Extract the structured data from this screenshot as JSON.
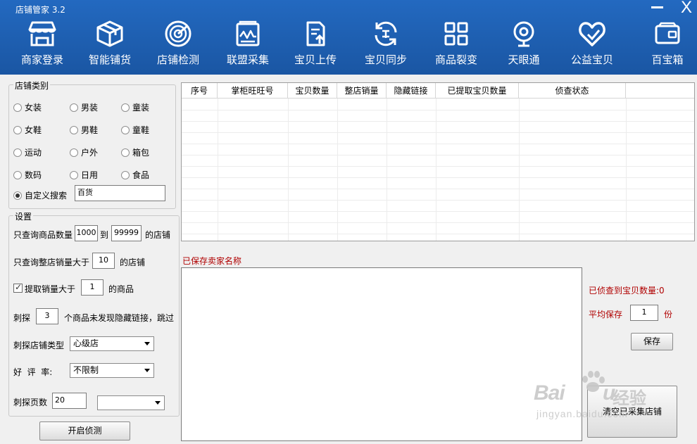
{
  "window": {
    "title": "店铺管家   3.2",
    "minimize_icon": "minimize-icon",
    "close_label": "X"
  },
  "nav": [
    {
      "label": "商家登录",
      "icon": "storefront-icon"
    },
    {
      "label": "智能铺货",
      "icon": "package-box-icon"
    },
    {
      "label": "店铺检测",
      "icon": "radar-icon"
    },
    {
      "label": "联盟采集",
      "icon": "pulse-chart-icon"
    },
    {
      "label": "宝贝上传",
      "icon": "document-upload-icon"
    },
    {
      "label": "宝贝同步",
      "icon": "sync-icon"
    },
    {
      "label": "商品裂变",
      "icon": "grid-icon"
    },
    {
      "label": "天眼通",
      "icon": "webcam-icon"
    },
    {
      "label": "公益宝贝",
      "icon": "heart-icon"
    },
    {
      "label": "百宝箱",
      "icon": "wallet-icon"
    }
  ],
  "category": {
    "title": "店铺类别",
    "options": [
      "女装",
      "男装",
      "童装",
      "女鞋",
      "男鞋",
      "童鞋",
      "运动",
      "户外",
      "箱包",
      "数码",
      "日用",
      "食品"
    ],
    "custom_label": "自定义搜索",
    "custom_value": "百货",
    "selected": "自定义搜索"
  },
  "settings": {
    "title": "设置",
    "qty_prefix": "只查询商品数量",
    "qty_min": "1000",
    "qty_to": "到",
    "qty_max": "99999",
    "qty_suffix": "的店铺",
    "sales_prefix": "只查询整店销量大于",
    "sales_value": "10",
    "sales_suffix": "的店铺",
    "extract_label": "提取销量大于",
    "extract_checked": true,
    "extract_value": "1",
    "extract_suffix": "的商品",
    "probe_prefix": "刺探",
    "probe_value": "3",
    "probe_suffix": "个商品未发现隐藏链接，跳过",
    "shop_type_label": "刺探店铺类型",
    "shop_type_value": "心级店",
    "rating_label": "好  评  率:",
    "rating_value": "不限制",
    "pages_label": "刺探页数",
    "pages_value": "20",
    "pages_select_value": ""
  },
  "start_button": "开启侦测",
  "table": {
    "columns": [
      "序号",
      "掌柜旺旺号",
      "宝贝数量",
      "整店销量",
      "隐藏链接",
      "已提取宝贝数量",
      "侦查状态"
    ],
    "rows": []
  },
  "saved": {
    "label": "已保存卖家名称",
    "value": ""
  },
  "stats": {
    "found_label": "已侦查到宝贝数量:0",
    "avg_label": "平均保存",
    "avg_value": "1",
    "avg_unit": "份",
    "save_button": "保存",
    "clear_button": "清空已采集店铺"
  },
  "watermark": {
    "brand": "Bai",
    "brand_tail": "u",
    "cn": "经验",
    "url": "jingyan.baidu.com"
  },
  "colors": {
    "header_bg": "#1f5fb0",
    "label_red": "#b00000"
  }
}
